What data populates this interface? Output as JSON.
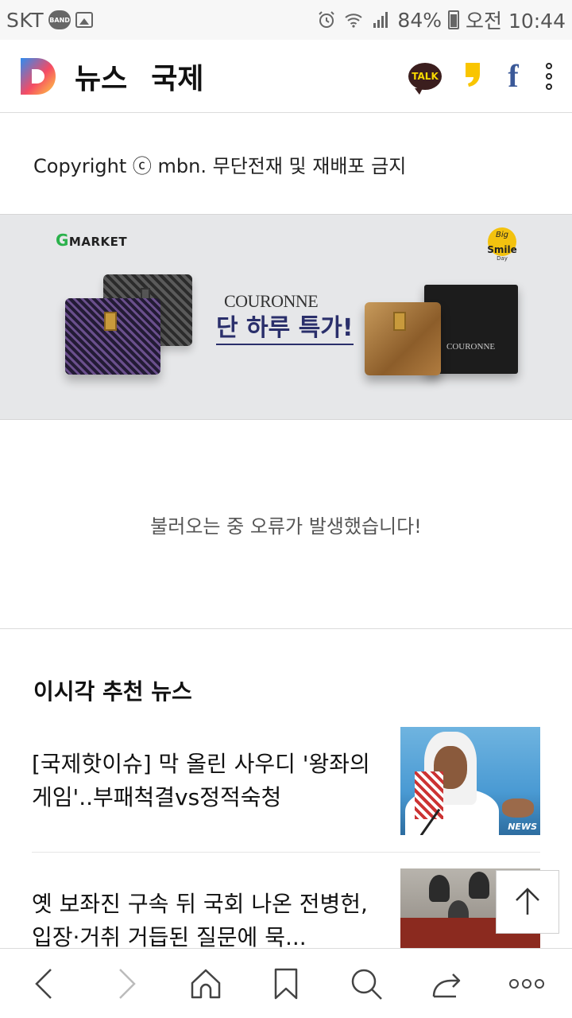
{
  "status_bar": {
    "carrier": "SKT",
    "band_badge": "BAND",
    "battery": "84%",
    "time": "오전 10:44",
    "icons": [
      "band-icon",
      "image-icon",
      "alarm-icon",
      "wifi-icon",
      "signal-icon",
      "battery-icon"
    ]
  },
  "header": {
    "app_name": "뉴스",
    "section": "국제",
    "talk_label": "TALK",
    "facebook_glyph": "f",
    "logo_letter": "D",
    "colors": {
      "logo_gradient": [
        "#2f8cf0",
        "#f54b64",
        "#ffd040"
      ],
      "talk_bg": "#3b1e1e",
      "talk_fg": "#f9d900",
      "facebook": "#3b5998"
    }
  },
  "copyright": "Copyright ⓒ mbn. 무단전재 및 재배포 금지",
  "ad": {
    "market_logo": "MARKET",
    "market_logo_g": "G",
    "badge_big": "Big",
    "badge_smile": "Smile",
    "badge_day": "Day",
    "brand": "COURONNE",
    "headline": "단 하루 특가!",
    "wallet_brand": "COURONNE"
  },
  "error_message": "불러오는 중 오류가 발생했습니다!",
  "recommended": {
    "title": "이시각 추천 뉴스",
    "items": [
      {
        "headline": "[국제핫이슈] 막 올린 사우디 '왕좌의 게임'..부패척결vs정적숙청",
        "thumb_watermark": "NEWS"
      },
      {
        "headline": "옛 보좌진 구속 뒤 국회 나온 전병헌, 입장·거취 거듭된 질문에 묵..."
      }
    ]
  },
  "bottom_nav": [
    "back-icon",
    "forward-icon",
    "home-icon",
    "bookmark-icon",
    "search-icon",
    "share-icon",
    "more-icon"
  ]
}
